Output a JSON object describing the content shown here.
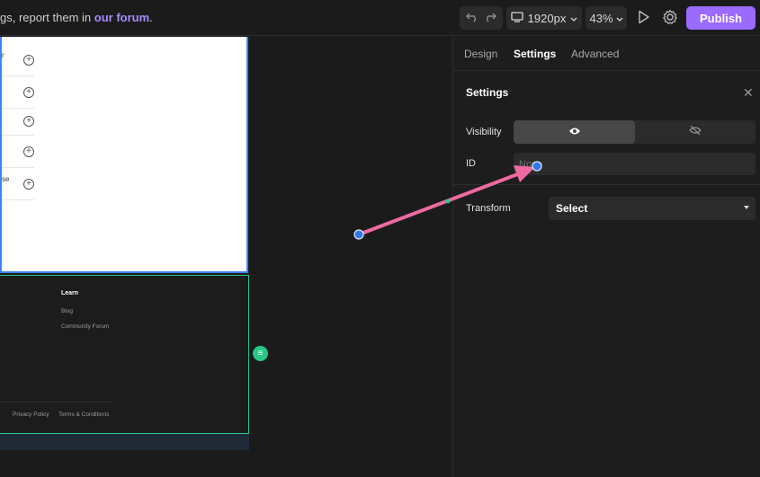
{
  "topbar": {
    "notice_prefix": "gs, report them in ",
    "notice_link": "our forum",
    "notice_suffix": ".",
    "device_label": "1920px",
    "zoom_label": "43%",
    "publish_label": "Publish"
  },
  "canvas": {
    "faq_fragments": [
      "r",
      "",
      "",
      "",
      "se"
    ],
    "footer": {
      "heading": "Learn",
      "links": [
        "Blog",
        "Community Forum"
      ],
      "legal": [
        "Privacy Policy",
        "Terms & Conditions"
      ]
    }
  },
  "panel": {
    "tabs": [
      "Design",
      "Settings",
      "Advanced"
    ],
    "active_tab": "Settings",
    "section_title": "Settings",
    "visibility_label": "Visibility",
    "id_label": "ID",
    "id_placeholder": "None",
    "transform_label": "Transform",
    "transform_value": "Select"
  },
  "colors": {
    "accent": "#9b6bff",
    "selection": "#3d84f5",
    "footer_border": "#27c788",
    "arrow": "#ef6aa0"
  }
}
